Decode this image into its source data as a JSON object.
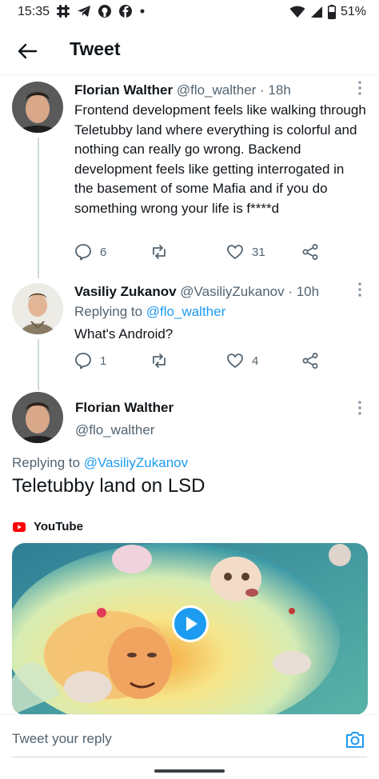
{
  "status_bar": {
    "time": "15:35",
    "left_icons": [
      "slack-icon",
      "telegram-icon",
      "github-icon",
      "facebook-icon",
      "dot-icon"
    ],
    "right_icons": [
      "wifi-icon",
      "signal-icon",
      "battery-icon"
    ],
    "battery": "51%"
  },
  "header": {
    "back_icon": "arrow-left-icon",
    "title": "Tweet"
  },
  "tweets": [
    {
      "display_name": "Florian Walther",
      "meta": "@flo_walther · 18h",
      "text": "Frontend development feels like walking through Teletubby land where everything is colorful and nothing can really go wrong. Backend development feels like getting interrogated in the basement of some Mafia and if you do something wrong your life is f****d",
      "replies": "6",
      "retweets": "",
      "likes": "31"
    },
    {
      "display_name": "Vasiliy Zukanov",
      "meta": "@VasiliyZukanov · 10h",
      "replying_prefix": "Replying to ",
      "replying_to": "@flo_walther",
      "text": "What's Android?",
      "replies": "1",
      "retweets": "",
      "likes": "4"
    }
  ],
  "focus_tweet": {
    "display_name": "Florian Walther",
    "handle": "@flo_walther",
    "replying_prefix": "Replying to ",
    "replying_to": "@VasiliyZukanov",
    "text": "Teletubby land on LSD",
    "embed_source": "YouTube"
  },
  "reply_bar": {
    "placeholder": "Tweet your reply",
    "camera_icon": "camera-icon"
  },
  "colors": {
    "accent": "#1d9bf0",
    "secondary_text": "#536471",
    "youtube_red": "#ff0000"
  }
}
